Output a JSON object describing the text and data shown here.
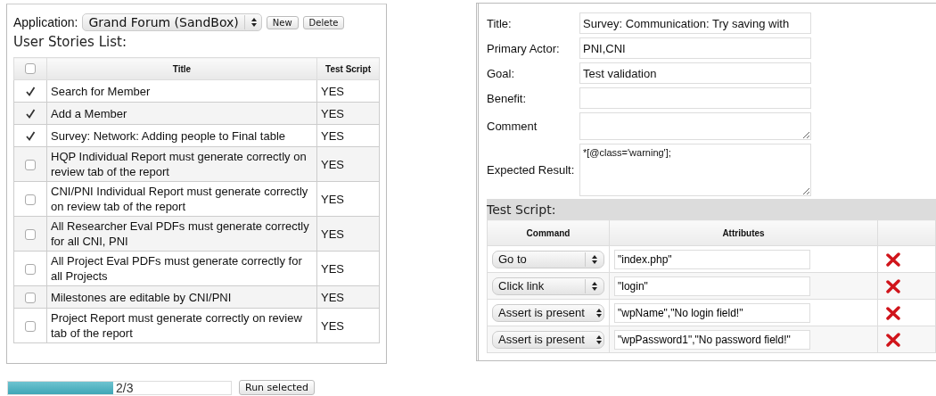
{
  "application": {
    "label": "Application:",
    "value": "Grand Forum (SandBox)",
    "buttons": [
      "New",
      "Delete"
    ]
  },
  "stories": {
    "heading": "User Stories List:",
    "all_checked": false,
    "columns": [
      "Title",
      "Test Script"
    ],
    "rows": [
      {
        "checked": true,
        "title": "Search for Member",
        "test_script": "YES"
      },
      {
        "checked": true,
        "title": "Add a Member",
        "test_script": "YES"
      },
      {
        "checked": true,
        "title": "Survey: Network: Adding people to Final table",
        "test_script": "YES"
      },
      {
        "checked": false,
        "title": "HQP Individual Report must generate correctly on review tab of the report",
        "test_script": "YES"
      },
      {
        "checked": false,
        "title": "CNI/PNI Individual Report must generate correctly on review tab of the report",
        "test_script": "YES"
      },
      {
        "checked": false,
        "title": "All Researcher Eval PDFs must generate correctly for all CNI, PNI",
        "test_script": "YES"
      },
      {
        "checked": false,
        "title": "All Project Eval PDFs must generate correctly for all Projects",
        "test_script": "YES"
      },
      {
        "checked": false,
        "title": "Milestones are editable by CNI/PNI",
        "test_script": "YES"
      },
      {
        "checked": false,
        "title": "Project Report must generate correctly on review tab of the report",
        "test_script": "YES"
      }
    ]
  },
  "progress": {
    "level": 0.47,
    "reading": "2/3"
  },
  "run_button": "Run selected",
  "form": {
    "fields": [
      {
        "kind": "input",
        "label": "Title:",
        "value": "Survey: Communication: Try saving with"
      },
      {
        "kind": "input",
        "label": "Primary Actor:",
        "value": "PNI,CNI"
      },
      {
        "kind": "input",
        "label": "Goal:",
        "value": "Test validation"
      },
      {
        "kind": "input",
        "label": "Benefit:"
      },
      {
        "kind": "textarea",
        "label": "Comment"
      },
      {
        "kind": "textarea_tall",
        "label": "Expected Result:",
        "value": "*[@class='warning'];"
      }
    ]
  },
  "test_script": {
    "heading": "Test Script:",
    "columns": [
      "Command",
      "Attributes"
    ],
    "rows": [
      {
        "command": "Go to",
        "attributes": "\"index.php\""
      },
      {
        "command": "Click link",
        "attributes": "\"login\""
      },
      {
        "command": "Assert is present",
        "attributes": "\"wpName\",\"No login field!\""
      },
      {
        "command": "Assert is present",
        "attributes": "\"wpPassword1\",\"No password field!\""
      }
    ]
  }
}
